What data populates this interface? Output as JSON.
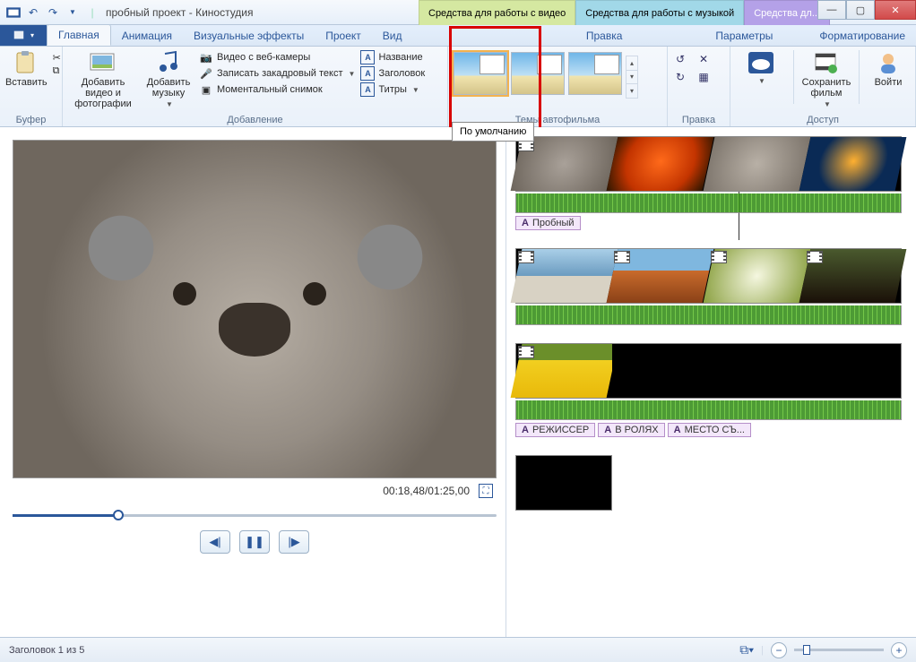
{
  "window": {
    "title": "пробный проект - Киностудия",
    "context_tabs": [
      "Средства для работы с видео",
      "Средства для работы с музыкой",
      "Средства дл..."
    ]
  },
  "tabs": {
    "file_dropdown_icon": "▾",
    "items": [
      "Главная",
      "Анимация",
      "Визуальные эффекты",
      "Проект",
      "Вид"
    ],
    "context_lower": [
      "Правка",
      "Параметры",
      "Форматирование"
    ],
    "active": "Главная"
  },
  "ribbon": {
    "buffer": {
      "label": "Буфер",
      "paste": "Вставить"
    },
    "add": {
      "label": "Добавление",
      "add_video": "Добавить видео и фотографии",
      "add_music": "Добавить музыку",
      "webcam": "Видео с веб-камеры",
      "narration": "Записать закадровый текст",
      "snapshot": "Моментальный снимок",
      "title": "Название",
      "caption": "Заголовок",
      "credits": "Титры"
    },
    "themes": {
      "label": "Темы автофильма"
    },
    "edit": {
      "label": "Правка"
    },
    "access": {
      "label": "Доступ",
      "save_movie": "Сохранить фильм",
      "login": "Войти"
    }
  },
  "tooltip": "По умолчанию",
  "preview": {
    "time": "00:18,48/01:25,00"
  },
  "timeline": {
    "title_chip_1": "Пробный",
    "credits": [
      "РЕЖИССЕР",
      "В РОЛЯХ",
      "МЕСТО СЪ..."
    ]
  },
  "status": {
    "caption": "Заголовок 1 из 5"
  }
}
